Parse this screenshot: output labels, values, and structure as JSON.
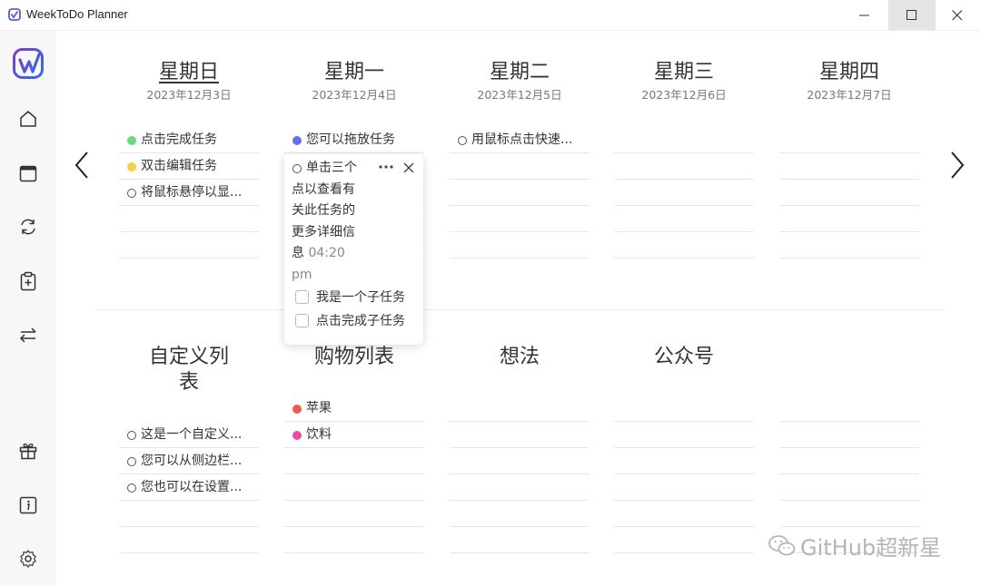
{
  "window": {
    "title": "WeekToDo Planner",
    "min_icon": "minimize-icon",
    "max_icon": "maximize-icon",
    "close_icon": "close-icon"
  },
  "sidebar": {
    "items": [
      {
        "name": "logo",
        "icon": "app-logo-icon"
      },
      {
        "name": "home",
        "icon": "home-icon"
      },
      {
        "name": "calendar",
        "icon": "calendar-icon"
      },
      {
        "name": "sync",
        "icon": "sync-icon"
      },
      {
        "name": "add-list",
        "icon": "clipboard-plus-icon"
      },
      {
        "name": "swap",
        "icon": "swap-arrows-icon"
      },
      {
        "name": "gift",
        "icon": "gift-icon"
      },
      {
        "name": "info",
        "icon": "info-icon"
      },
      {
        "name": "settings",
        "icon": "gear-icon"
      }
    ]
  },
  "colors": {
    "green": "#6ed77a",
    "yellow": "#f6cf44",
    "blue": "#6172ea",
    "red": "#ee5a4d",
    "pink": "#ea4ca1",
    "brand_purple": "#6d3fc9",
    "brand_blue": "#2f6cf0"
  },
  "days": [
    {
      "name": "星期日",
      "date": "2023年12月3日",
      "tasks": [
        {
          "text": "点击完成任务",
          "dot": "green"
        },
        {
          "text": "双击编辑任务",
          "dot": "yellow"
        },
        {
          "text": "将鼠标悬停以显...",
          "dot": "hollow"
        }
      ]
    },
    {
      "name": "星期一",
      "date": "2023年12月4日",
      "tasks": [
        {
          "text": "您可以拖放任务",
          "dot": "blue"
        }
      ]
    },
    {
      "name": "星期二",
      "date": "2023年12月5日",
      "tasks": [
        {
          "text": "用鼠标点击快速...",
          "dot": "hollow"
        }
      ]
    },
    {
      "name": "星期三",
      "date": "2023年12月6日",
      "tasks": []
    },
    {
      "name": "星期四",
      "date": "2023年12月7日",
      "tasks": []
    }
  ],
  "lists": [
    {
      "title": "自定义列表",
      "tasks": [
        {
          "text": "这是一个自定义...",
          "dot": "hollow"
        },
        {
          "text": "您可以从侧边栏...",
          "dot": "hollow"
        },
        {
          "text": "您也可以在设置...",
          "dot": "hollow"
        }
      ]
    },
    {
      "title": "购物列表",
      "tasks": [
        {
          "text": "苹果",
          "dot": "red"
        },
        {
          "text": "饮料",
          "dot": "pink"
        }
      ]
    },
    {
      "title": "想法",
      "tasks": []
    },
    {
      "title": "公众号",
      "tasks": []
    }
  ],
  "popup": {
    "lines": [
      "单击三个",
      "点以查看有",
      "关此任务的",
      "更多详细信",
      "息"
    ],
    "time": "04:20",
    "time_suffix": "pm",
    "more_icon": "more-dots-icon",
    "close_icon": "close-icon",
    "subtasks": [
      "我是一个子任务",
      "点击完成子任务"
    ]
  },
  "watermark": {
    "text": "GitHub超新星",
    "icon": "wechat-icon"
  }
}
